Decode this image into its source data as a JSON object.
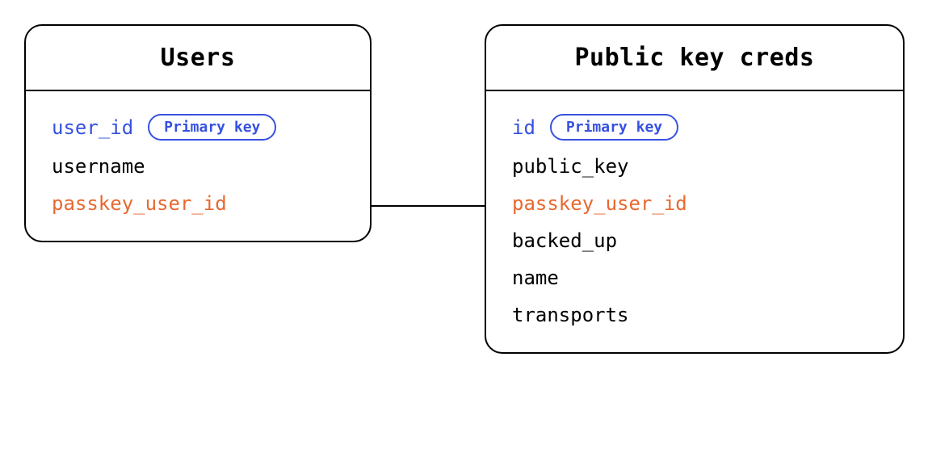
{
  "entities": {
    "users": {
      "title": "Users",
      "fields": {
        "user_id": "user_id",
        "username": "username",
        "passkey_user_id": "passkey_user_id"
      },
      "pk_label": "Primary key"
    },
    "creds": {
      "title": "Public key creds",
      "fields": {
        "id": "id",
        "public_key": "public_key",
        "passkey_user_id": "passkey_user_id",
        "backed_up": "backed_up",
        "name": "name",
        "transports": "transports"
      },
      "pk_label": "Primary key"
    }
  }
}
